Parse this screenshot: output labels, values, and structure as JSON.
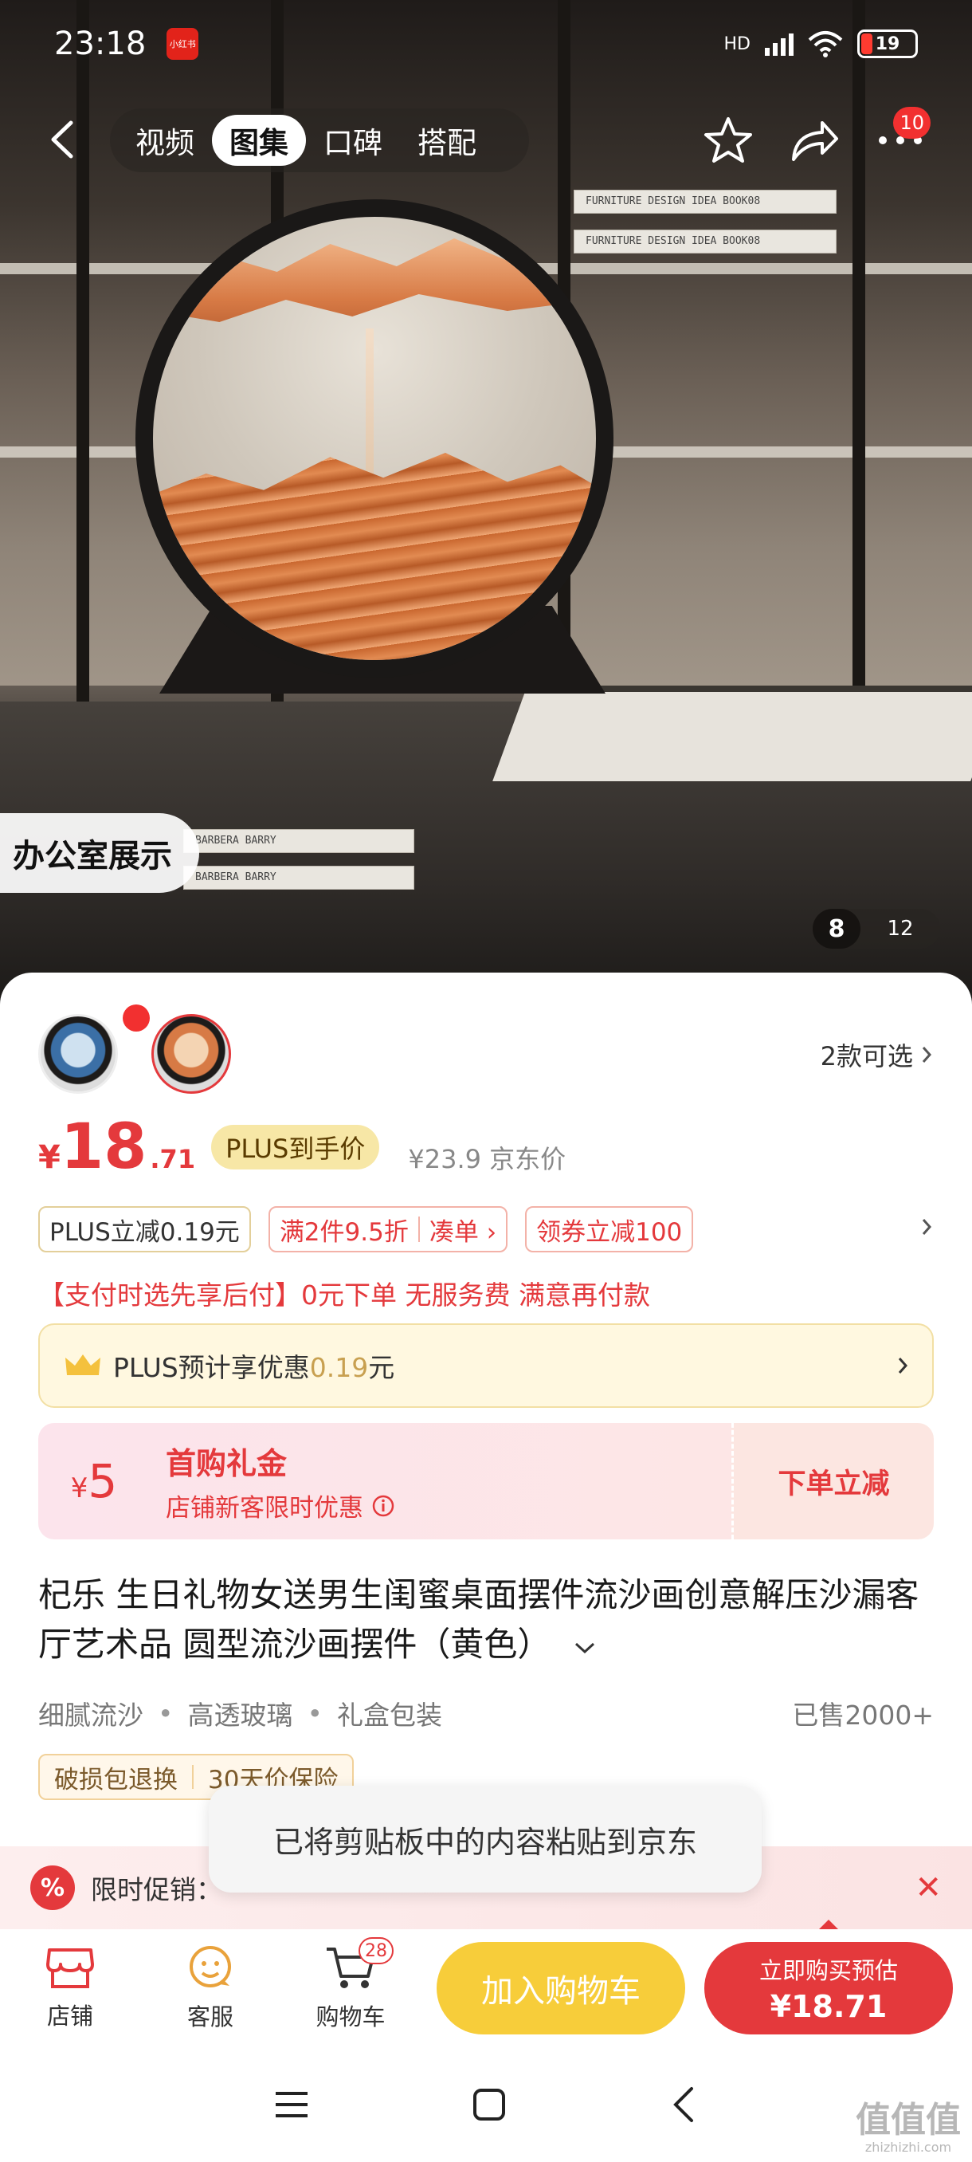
{
  "status_bar": {
    "time": "23:18",
    "app_badge": "小红书",
    "network": "HD",
    "wifi_sub": "6",
    "battery": "19"
  },
  "top_nav": {
    "tabs": [
      {
        "label": "视频",
        "active": false
      },
      {
        "label": "图集",
        "active": true
      },
      {
        "label": "口碑",
        "active": false
      },
      {
        "label": "搭配",
        "active": false
      }
    ],
    "more_badge": "10"
  },
  "gallery": {
    "scene_label": "办公室展示",
    "current_page": "8",
    "total_pages": "12",
    "book_texts": [
      "FURNITURE DESIGN IDEA BOOK08",
      "FURNITURE DESIGN IDEA BOOK08",
      "BARBERA BARRY",
      "BARBERA BARRY"
    ]
  },
  "variants": {
    "count_label": "2款可选"
  },
  "price": {
    "symbol": "¥",
    "integer": "18",
    "decimal": ".71",
    "plus_tag": "PLUS到手价",
    "original": "¥23.9 京东价"
  },
  "promo_tags": [
    {
      "text": "PLUS立减0.19元",
      "kind": "plus"
    },
    {
      "text": "满2件9.5折",
      "extra": "凑单 ›",
      "kind": "deal"
    },
    {
      "text": "领券立减100",
      "kind": "deal"
    }
  ],
  "after_pay": "【支付时选先享后付】0元下单 无服务费 满意再付款",
  "plus_bar": {
    "prefix": "PLUS预计享优惠",
    "amount": "0.19",
    "suffix": "元"
  },
  "coupon": {
    "symbol": "¥",
    "value": "5",
    "title": "首购礼金",
    "subtitle": "店铺新客限时优惠",
    "action": "下单立减"
  },
  "product": {
    "title": "杞乐 生日礼物女送男生闺蜜桌面摆件流沙画创意解压沙漏客厅艺术品 圆型流沙画摆件（黄色）",
    "features": [
      "细腻流沙",
      "高透玻璃",
      "礼盒包装"
    ],
    "sold": "已售2000+",
    "services": [
      "破损包退换",
      "30天价保险"
    ]
  },
  "promo_banner": {
    "icon_text": "%",
    "label": "限时促销："
  },
  "toast": "已将剪贴板中的内容粘贴到京东",
  "action_bar": {
    "shop": "店铺",
    "service": "客服",
    "cart": "购物车",
    "cart_count": "28",
    "add_to_cart": "加入购物车",
    "buy_line1": "立即购买预估",
    "buy_line2": "¥18.71"
  },
  "watermark": {
    "main": "值值值",
    "sub": "zhizhizhi.com"
  },
  "colors": {
    "accent_red": "#e4393c",
    "cart_yellow": "#f7cd3a",
    "plus_gold": "#f7e7a6"
  }
}
